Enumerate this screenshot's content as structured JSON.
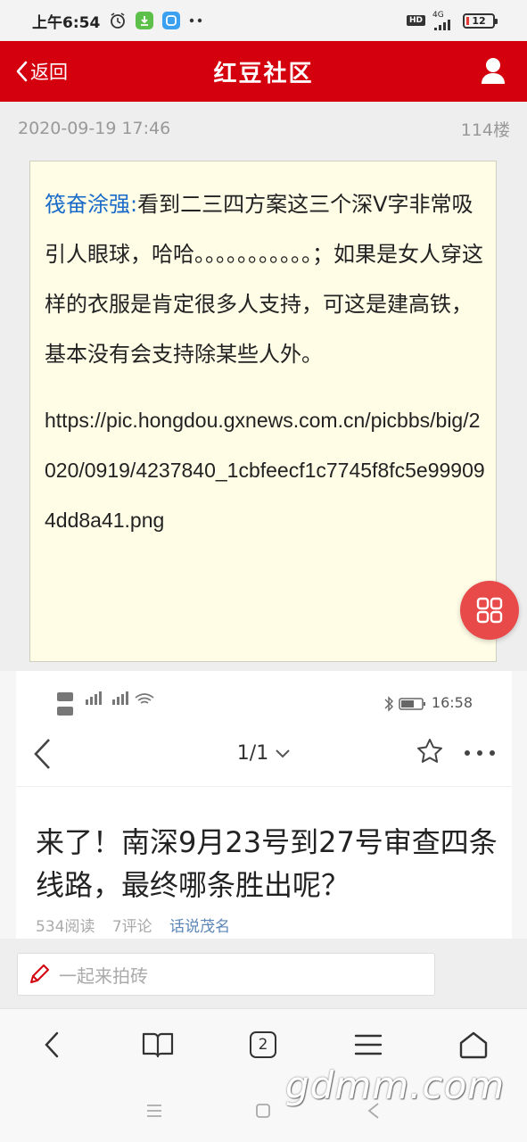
{
  "status_bar": {
    "time": "上午6:54",
    "network": "4G",
    "battery": "12"
  },
  "header": {
    "back_label": "返回",
    "title": "红豆社区"
  },
  "post": {
    "date": "2020-09-19 17:46",
    "floor": "114楼",
    "author": "筏奋涂强:",
    "text": "看到二三四方案这三个深V字非常吸引人眼球，哈哈。。。。。。。。。。。；如果是女人穿这样的衣服是肯定很多人支持，可这是建高铁，基本没有会支持除某些人外。",
    "link": "https://pic.hongdou.gxnews.com.cn/picbbs/big/2020/0919/4237840_1cbfeecf1c7745f8fc5e999094dd8a41.png"
  },
  "embedded": {
    "time": "16:58",
    "page_indicator": "1/1",
    "headline": "来了！南深9月23号到27号审查四条线路，最终哪条胜出呢？",
    "reads": "534阅读",
    "comments": "7评论",
    "author": "话说茂名"
  },
  "comment": {
    "placeholder": "一起来拍砖"
  },
  "toolbar": {
    "tab_count": "2"
  },
  "watermark": "gdmm.com",
  "colors": {
    "brand_red": "#d4000e",
    "author_blue": "#1a6bc9",
    "fab_red": "#e84a4a"
  }
}
